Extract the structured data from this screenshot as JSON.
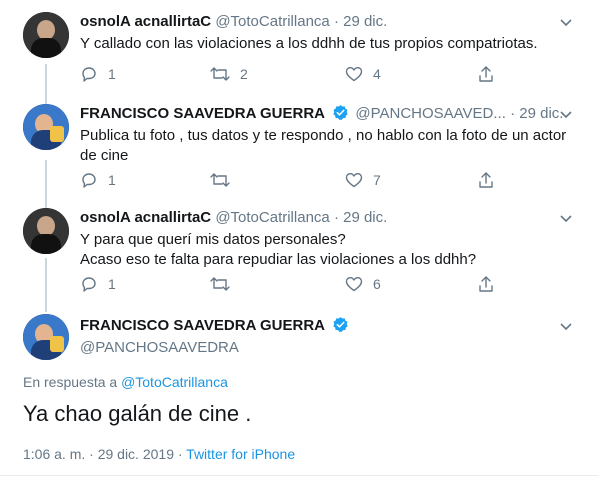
{
  "tweets": [
    {
      "name": "osnolA acnallirtaC",
      "handle": "@TotoCatrillanca",
      "dot": "·",
      "date": "29 dic.",
      "lines": [
        "Y callado con las violaciones a los ddhh de tus propios compatriotas."
      ],
      "replies": "1",
      "retweets": "2",
      "likes": "4"
    },
    {
      "name": "FRANCISCO SAAVEDRA GUERRA",
      "handle": "@PANCHOSAAVED...",
      "dot": "·",
      "date": "29 dic.",
      "lines": [
        "Publica tu foto , tus datos y te respondo , no hablo con la foto de  un actor",
        "de cine"
      ],
      "replies": "1",
      "retweets": "",
      "likes": "7"
    },
    {
      "name": "osnolA acnallirtaC",
      "handle": "@TotoCatrillanca",
      "dot": "·",
      "date": "29 dic.",
      "lines": [
        "Y para que querí mis datos personales?",
        "Acaso eso te falta para repudiar las violaciones a los ddhh?"
      ],
      "replies": "1",
      "retweets": "",
      "likes": "6"
    }
  ],
  "main_tweet": {
    "name": "FRANCISCO SAAVEDRA GUERRA",
    "handle": "@PANCHOSAAVEDRA",
    "reply_prefix": "En respuesta a",
    "reply_to": "@TotoCatrillanca",
    "text": "Ya chao galán de cine .",
    "timestamp": "1:06 a. m. · 29 dic. 2019 ·",
    "app": "Twitter for iPhone"
  },
  "icons": {
    "reply": "reply-icon",
    "retweet": "retweet-icon",
    "like": "heart-icon",
    "share": "share-icon",
    "verified": "verified-badge-icon",
    "more": "chevron-down-icon"
  },
  "colors": {
    "link": "#1b95e0",
    "secondary": "#657786",
    "verified": "#1da1f2",
    "thread_line": "#ccd6dd"
  }
}
